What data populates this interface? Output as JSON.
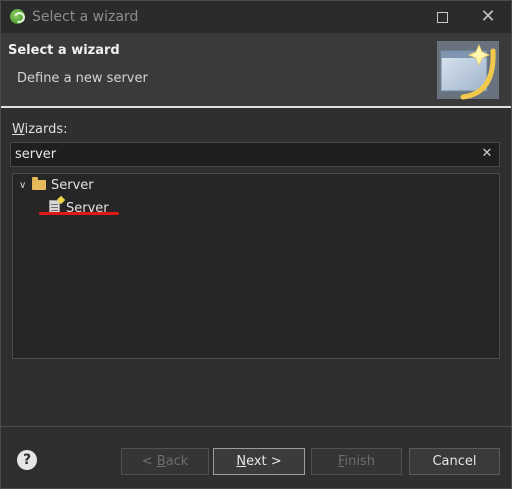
{
  "window": {
    "title": "Select a wizard",
    "maximize_icon": "maximize-icon",
    "close_glyph": "✕"
  },
  "header": {
    "title": "Select a wizard",
    "description": "Define a new server"
  },
  "wizards": {
    "label_prefix": "W",
    "label_rest": "izards:",
    "filter_value": "server",
    "clear_glyph": "✕",
    "tree": [
      {
        "label": "Server",
        "type": "folder",
        "expanded": true,
        "children": [
          {
            "label": "Server",
            "type": "wizard",
            "selected": false
          }
        ]
      }
    ]
  },
  "footer": {
    "help_glyph": "?",
    "back": {
      "prefix": "< ",
      "mnemonic": "B",
      "rest": "ack",
      "enabled": false
    },
    "next": {
      "mnemonic": "N",
      "rest": "ext >",
      "enabled": true
    },
    "finish": {
      "mnemonic": "F",
      "rest": "inish",
      "enabled": false
    },
    "cancel": {
      "label": "Cancel",
      "enabled": true
    }
  },
  "colors": {
    "accent_underline": "#e01818",
    "background": "#2f2f2f"
  }
}
